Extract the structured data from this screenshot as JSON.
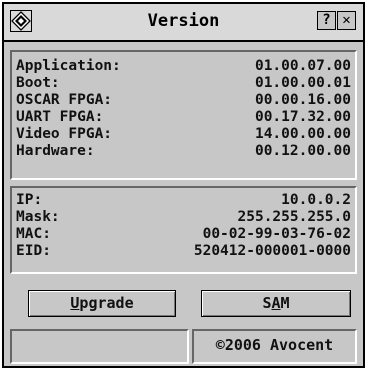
{
  "window": {
    "title": "Version",
    "help_label": "?",
    "close_label": "✕",
    "icon": "diamond-logo-icon"
  },
  "versions": [
    {
      "label": "Application:",
      "value": "01.00.07.00"
    },
    {
      "label": "Boot:",
      "value": "01.00.00.01"
    },
    {
      "label": "OSCAR FPGA:",
      "value": "00.00.16.00"
    },
    {
      "label": "UART FPGA:",
      "value": "00.17.32.00"
    },
    {
      "label": "Video FPGA:",
      "value": "14.00.00.00"
    },
    {
      "label": "Hardware:",
      "value": "00.12.00.00"
    }
  ],
  "network": [
    {
      "label": "IP:",
      "value": "10.0.0.2"
    },
    {
      "label": "Mask:",
      "value": "255.255.255.0"
    },
    {
      "label": "MAC:",
      "value": "00-02-99-03-76-02"
    },
    {
      "label": "EID:",
      "value": "520412-000001-0000"
    }
  ],
  "buttons": {
    "upgrade_hotkey": "U",
    "upgrade_rest": "pgrade",
    "sam_pre": "S",
    "sam_hotkey": "A",
    "sam_post": "M"
  },
  "status": {
    "left": "",
    "copyright": "©2006 Avocent"
  }
}
